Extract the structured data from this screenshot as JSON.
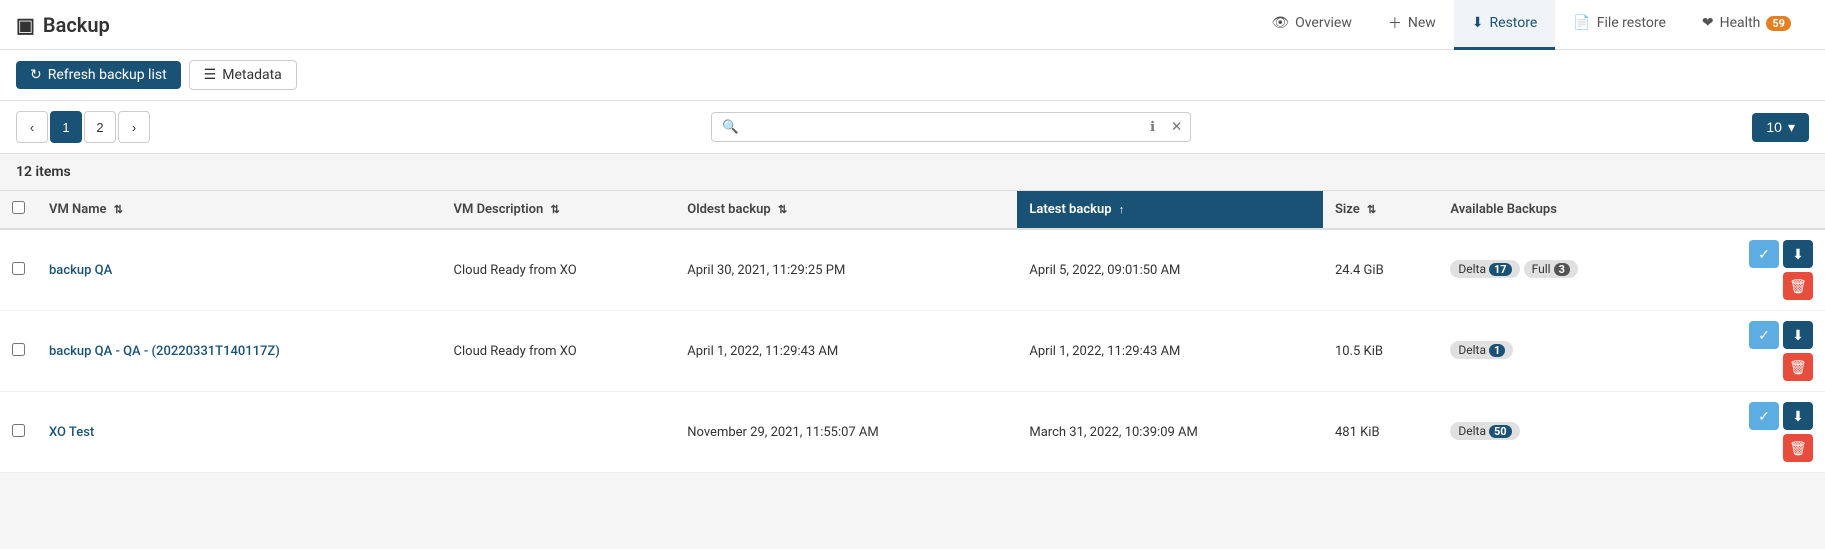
{
  "header": {
    "title": "Backup",
    "icon": "🖫",
    "nav": [
      {
        "id": "overview",
        "label": "Overview",
        "icon": "👁",
        "active": false
      },
      {
        "id": "new",
        "label": "New",
        "icon": "+",
        "active": false
      },
      {
        "id": "restore",
        "label": "Restore",
        "icon": "⬇",
        "active": true
      },
      {
        "id": "file-restore",
        "label": "File restore",
        "icon": "📄",
        "active": false
      },
      {
        "id": "health",
        "label": "Health",
        "icon": "❤",
        "active": false,
        "badge": "59"
      }
    ]
  },
  "toolbar": {
    "refresh_label": "Refresh backup list",
    "metadata_label": "Metadata"
  },
  "controls": {
    "pages": [
      {
        "label": "‹",
        "num": "prev"
      },
      {
        "label": "1",
        "num": "1",
        "active": true
      },
      {
        "label": "2",
        "num": "2"
      },
      {
        "label": "›",
        "num": "next"
      }
    ],
    "search_placeholder": "",
    "per_page": "10"
  },
  "table": {
    "items_count": "12 items",
    "columns": [
      {
        "id": "vm-name",
        "label": "VM Name",
        "sortable": true,
        "active": false
      },
      {
        "id": "vm-description",
        "label": "VM Description",
        "sortable": true,
        "active": false
      },
      {
        "id": "oldest-backup",
        "label": "Oldest backup",
        "sortable": true,
        "active": false
      },
      {
        "id": "latest-backup",
        "label": "Latest backup",
        "sortable": true,
        "active": true,
        "sort_dir": "asc"
      },
      {
        "id": "size",
        "label": "Size",
        "sortable": true,
        "active": false
      },
      {
        "id": "available-backups",
        "label": "Available Backups",
        "sortable": false,
        "active": false
      }
    ],
    "rows": [
      {
        "vm_name": "backup QA",
        "vm_description": "Cloud Ready from XO",
        "oldest_backup": "April 30, 2021, 11:29:25 PM",
        "latest_backup": "April 5, 2022, 09:01:50 AM",
        "size": "24.4 GiB",
        "tags": [
          {
            "type": "Delta",
            "count": "17"
          },
          {
            "type": "Full",
            "count": "3"
          }
        ]
      },
      {
        "vm_name": "backup QA - QA - (20220331T140117Z)",
        "vm_description": "Cloud Ready from XO",
        "oldest_backup": "April 1, 2022, 11:29:43 AM",
        "latest_backup": "April 1, 2022, 11:29:43 AM",
        "size": "10.5 KiB",
        "tags": [
          {
            "type": "Delta",
            "count": "1"
          }
        ]
      },
      {
        "vm_name": "XO Test",
        "vm_description": "",
        "oldest_backup": "November 29, 2021, 11:55:07 AM",
        "latest_backup": "March 31, 2022, 10:39:09 AM",
        "size": "481 KiB",
        "tags": [
          {
            "type": "Delta",
            "count": "50"
          }
        ]
      }
    ]
  }
}
